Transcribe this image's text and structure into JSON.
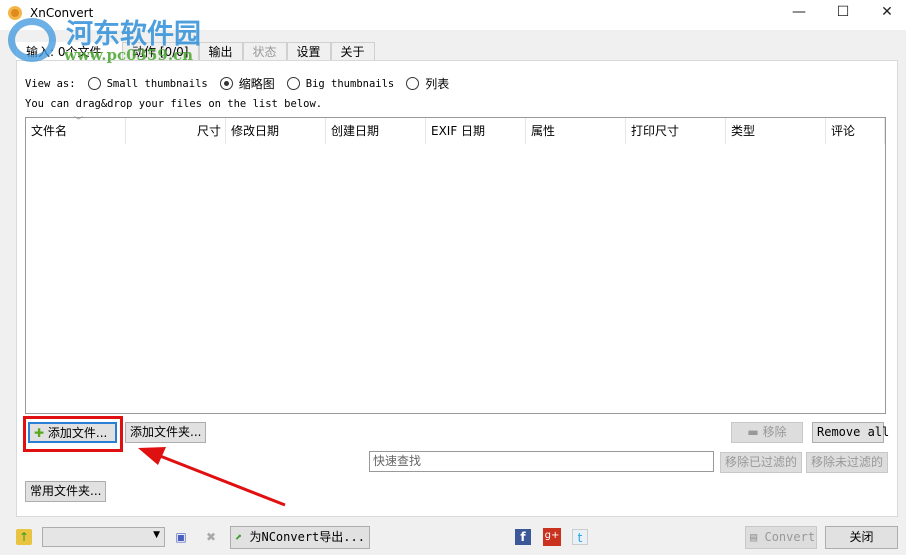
{
  "window": {
    "title": "XnConvert",
    "minimize": "—",
    "maximize": "☐",
    "close": "✕"
  },
  "watermark": {
    "name": "河东软件园",
    "url": "www.pc0359.cn"
  },
  "tabs": [
    {
      "label": "输入: 0个文件",
      "state": "active"
    },
    {
      "label": "动作 [0/0]",
      "state": "normal"
    },
    {
      "label": "输出",
      "state": "normal"
    },
    {
      "label": "状态",
      "state": "disabled"
    },
    {
      "label": "设置",
      "state": "normal"
    },
    {
      "label": "关于",
      "state": "normal"
    }
  ],
  "view": {
    "label": "View as:",
    "options": [
      "Small thumbnails",
      "缩略图",
      "Big thumbnails",
      "列表"
    ],
    "selected": "缩略图"
  },
  "hint": "You can drag&drop your files on the list below.",
  "columns": [
    "文件名",
    "尺寸",
    "修改日期",
    "创建日期",
    "EXIF 日期",
    "属性",
    "打印尺寸",
    "类型",
    "评论"
  ],
  "buttons": {
    "add_files": "添加文件...",
    "add_folder": "添加文件夹...",
    "remove": "移除",
    "remove_all": "Remove all",
    "remove_filtered": "移除已过滤的",
    "remove_unfiltered": "移除未过滤的",
    "favorite_folders": "常用文件夹...",
    "export_nconvert": "为NConvert导出...",
    "convert": "Convert",
    "close": "关闭"
  },
  "search": {
    "placeholder": "快速查找"
  },
  "colors": {
    "highlight": "#e01010",
    "accent": "#2f8fd8"
  }
}
